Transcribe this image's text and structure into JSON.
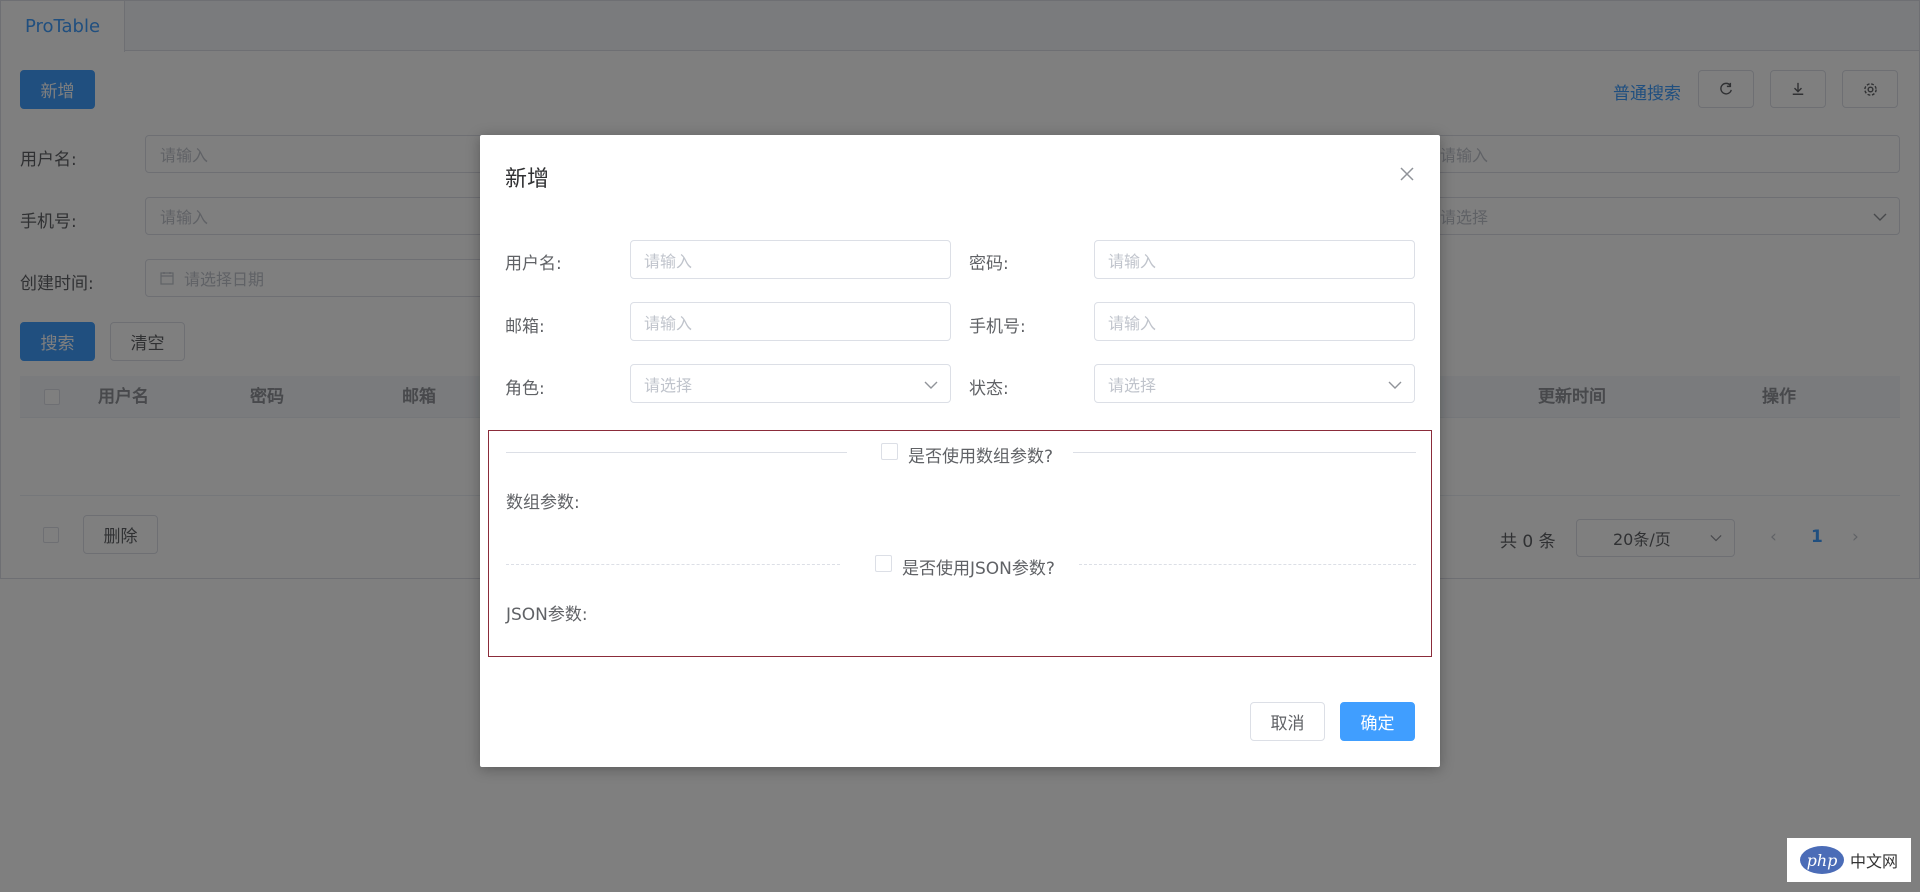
{
  "tabs": {
    "active_label": "ProTable"
  },
  "toolbar": {
    "add_label": "新增",
    "normal_search_label": "普通搜索",
    "refresh_icon": "refresh-icon",
    "download_icon": "download-icon",
    "settings_icon": "gear-icon"
  },
  "search_form": {
    "username_label": "用户名:",
    "username_placeholder": "请输入",
    "phone_label": "手机号:",
    "phone_placeholder": "请输入",
    "created_label": "创建时间:",
    "created_placeholder": "请选择日期",
    "right_input_placeholder": "请输入",
    "right_select_placeholder": "请选择",
    "search_label": "搜索",
    "clear_label": "清空"
  },
  "table": {
    "columns": [
      "用户名",
      "密码",
      "邮箱",
      "更新时间",
      "操作"
    ],
    "delete_label": "删除"
  },
  "pagination": {
    "total": "共 0 条",
    "page_size": "20条/页",
    "current_page": "1"
  },
  "dialog": {
    "title": "新增",
    "fields": {
      "username_label": "用户名:",
      "username_placeholder": "请输入",
      "password_label": "密码:",
      "password_placeholder": "请输入",
      "email_label": "邮箱:",
      "email_placeholder": "请输入",
      "phone_label": "手机号:",
      "phone_placeholder": "请输入",
      "role_label": "角色:",
      "role_placeholder": "请选择",
      "status_label": "状态:",
      "status_placeholder": "请选择"
    },
    "array_toggle_label": "是否使用数组参数?",
    "array_params_label": "数组参数:",
    "json_toggle_label": "是否使用JSON参数?",
    "json_params_label": "JSON参数:",
    "cancel_label": "取消",
    "confirm_label": "确定"
  },
  "watermark": {
    "logo": "php",
    "text": "中文网"
  },
  "colors": {
    "primary": "#409eff",
    "highlight_border": "#8b2c3a"
  }
}
